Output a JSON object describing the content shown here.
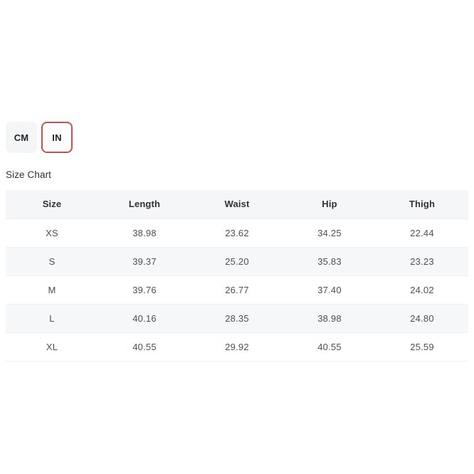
{
  "units": {
    "options": [
      {
        "label": "CM",
        "name": "unit-button-cm",
        "active": false
      },
      {
        "label": "IN",
        "name": "unit-button-in",
        "active": true
      }
    ],
    "selected": "IN",
    "active_border_color": "#c9504f",
    "inactive_background_color": "#f4f5f6"
  },
  "size_chart": {
    "title": "Size Chart",
    "columns": [
      "Size",
      "Length",
      "Waist",
      "Hip",
      "Thigh"
    ],
    "rows": [
      {
        "size": "XS",
        "length": "38.98",
        "waist": "23.62",
        "hip": "34.25",
        "thigh": "22.44"
      },
      {
        "size": "S",
        "length": "39.37",
        "waist": "25.20",
        "hip": "35.83",
        "thigh": "23.23"
      },
      {
        "size": "M",
        "length": "39.76",
        "waist": "26.77",
        "hip": "37.40",
        "thigh": "24.02"
      },
      {
        "size": "L",
        "length": "40.16",
        "waist": "28.35",
        "hip": "38.98",
        "thigh": "24.80"
      },
      {
        "size": "XL",
        "length": "40.55",
        "waist": "29.92",
        "hip": "40.55",
        "thigh": "25.59"
      }
    ],
    "header_background_color": "#f5f6f7",
    "stripe_background_color": "#f6f7f8"
  }
}
